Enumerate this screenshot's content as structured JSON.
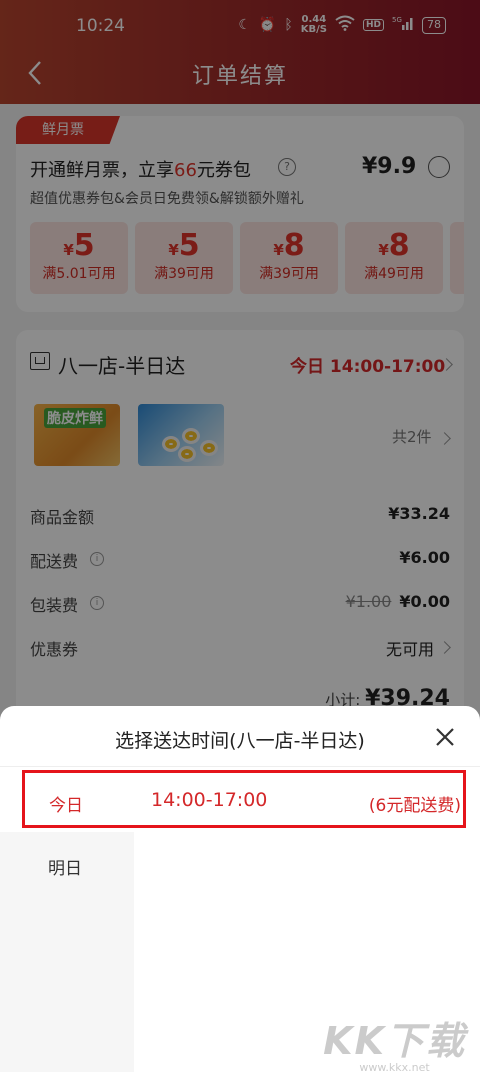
{
  "status_bar": {
    "time": "10:24",
    "speed": "0.44",
    "speed_unit": "KB/S",
    "hd": "HD",
    "network": "5G",
    "battery": "78"
  },
  "header": {
    "title": "订单结算"
  },
  "membership": {
    "tag": "鲜月票",
    "title_prefix": "开通鲜月票，立享",
    "title_number": "66",
    "title_suffix": "元券包",
    "help": "?",
    "price": "¥9.9",
    "subtitle": "超值优惠券包&会员日免费领&解锁额外赠礼",
    "coupons": [
      {
        "currency": "¥",
        "amount": "5",
        "condition": "满5.01可用"
      },
      {
        "currency": "¥",
        "amount": "5",
        "condition": "满39可用"
      },
      {
        "currency": "¥",
        "amount": "8",
        "condition": "满39可用"
      },
      {
        "currency": "¥",
        "amount": "8",
        "condition": "满49可用"
      }
    ]
  },
  "order": {
    "store_name": "八一店-半日达",
    "delivery_time": "今日 14:00-17:00",
    "product1_label": "脆皮炸鲜",
    "total_items": "共2件",
    "rows": [
      {
        "label": "商品金额",
        "value": "¥33.24"
      },
      {
        "label": "配送费",
        "value": "¥6.00",
        "info": "i"
      },
      {
        "label": "包装费",
        "original": "¥1.00",
        "value": "¥0.00",
        "info": "i"
      },
      {
        "label": "优惠券",
        "value": "无可用"
      }
    ],
    "subtotal_label": "小计:",
    "subtotal_value": "¥39.24"
  },
  "sheet": {
    "title": "选择送达时间(八一店-半日达)",
    "selected": {
      "day": "今日",
      "time": "14:00-17:00",
      "fee": "(6元配送费)"
    },
    "other_day": "明日"
  },
  "watermark": {
    "big": "KK下载",
    "small": "www.kkx.net"
  },
  "colors": {
    "accent_red": "#d4282a",
    "header_left": "#b8452f",
    "header_right": "#8a1628",
    "highlight_border": "#e5141b"
  }
}
